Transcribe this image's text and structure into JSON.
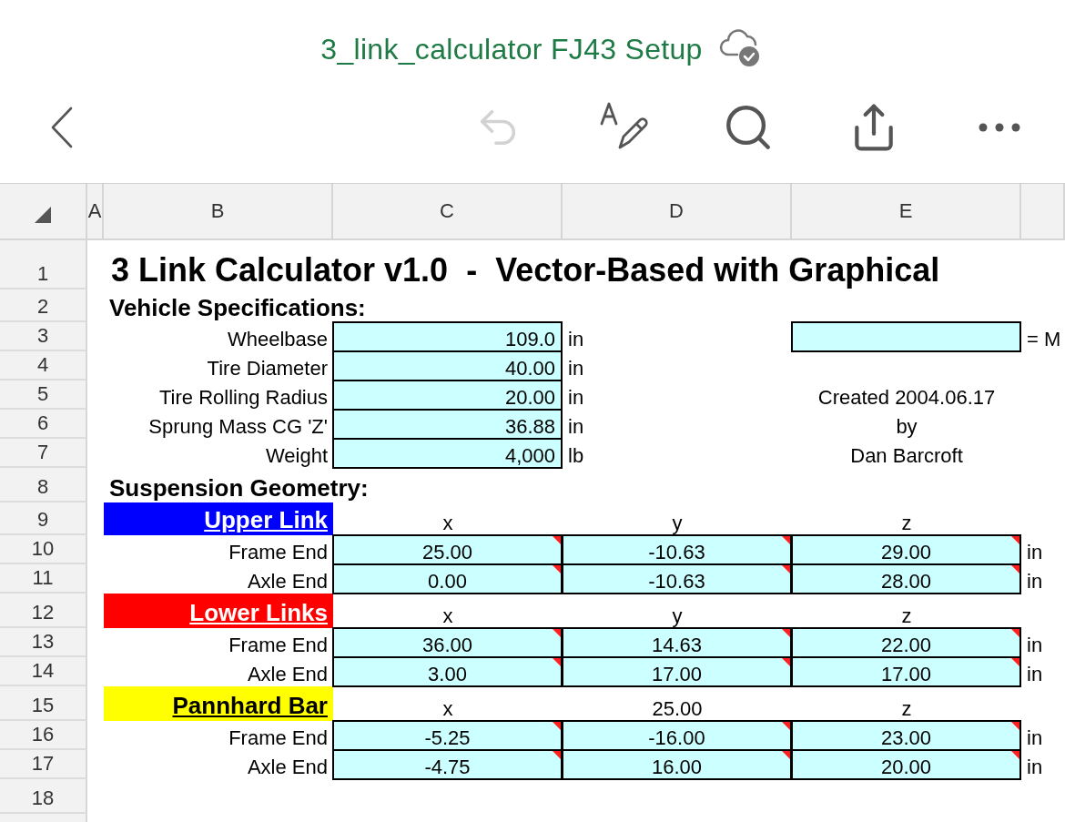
{
  "document": {
    "title": "3_link_calculator FJ43 Setup"
  },
  "toolbar": {
    "undo": {
      "disabled": true
    }
  },
  "columns": [
    "A",
    "B",
    "C",
    "D",
    "E"
  ],
  "row_numbers": [
    "1",
    "2",
    "3",
    "4",
    "5",
    "6",
    "7",
    "8",
    "9",
    "10",
    "11",
    "12",
    "13",
    "14",
    "15",
    "16",
    "17",
    "18"
  ],
  "sheet": {
    "title": "3 Link Calculator v1.0  -  Vector-Based with Graphical",
    "vehicle_heading": "Vehicle Specifications:",
    "specs": [
      {
        "label": "Wheelbase",
        "value": "109.0",
        "unit": "in"
      },
      {
        "label": "Tire Diameter",
        "value": "40.00",
        "unit": "in"
      },
      {
        "label": "Tire Rolling Radius",
        "value": "20.00",
        "unit": "in"
      },
      {
        "label": "Sprung Mass CG 'Z'",
        "value": "36.88",
        "unit": "in"
      },
      {
        "label": "Weight",
        "value": "4,000",
        "unit": "lb"
      }
    ],
    "side_field": {
      "suffix": "= M"
    },
    "credits": [
      "Created 2004.06.17",
      "by",
      "Dan Barcroft"
    ],
    "suspension_heading": "Suspension Geometry:",
    "groups": [
      {
        "name": "Upper Link",
        "color": "#0000ff",
        "headers": [
          "x",
          "y",
          "z"
        ],
        "rows": [
          {
            "label": "Frame End",
            "values": [
              "25.00",
              "-10.63",
              "29.00"
            ],
            "unit": "in",
            "flagged": true
          },
          {
            "label": "Axle End",
            "values": [
              "0.00",
              "-10.63",
              "28.00"
            ],
            "unit": "in",
            "flagged": true
          }
        ]
      },
      {
        "name": "Lower Links",
        "color": "#ff0000",
        "headers": [
          "x",
          "y",
          "z"
        ],
        "rows": [
          {
            "label": "Frame End",
            "values": [
              "36.00",
              "14.63",
              "22.00"
            ],
            "unit": "in",
            "flagged": true
          },
          {
            "label": "Axle End",
            "values": [
              "3.00",
              "17.00",
              "17.00"
            ],
            "unit": "in",
            "flagged": true
          }
        ]
      },
      {
        "name": "Pannhard Bar",
        "color": "#ffff00",
        "headers": [
          "x",
          "25.00",
          "z"
        ],
        "rows": [
          {
            "label": "Frame End",
            "values": [
              "-5.25",
              "-16.00",
              "23.00"
            ],
            "unit": "in",
            "flagged": true
          },
          {
            "label": "Axle End",
            "values": [
              "-4.75",
              "16.00",
              "20.00"
            ],
            "unit": "in",
            "flagged": true
          }
        ]
      }
    ]
  }
}
